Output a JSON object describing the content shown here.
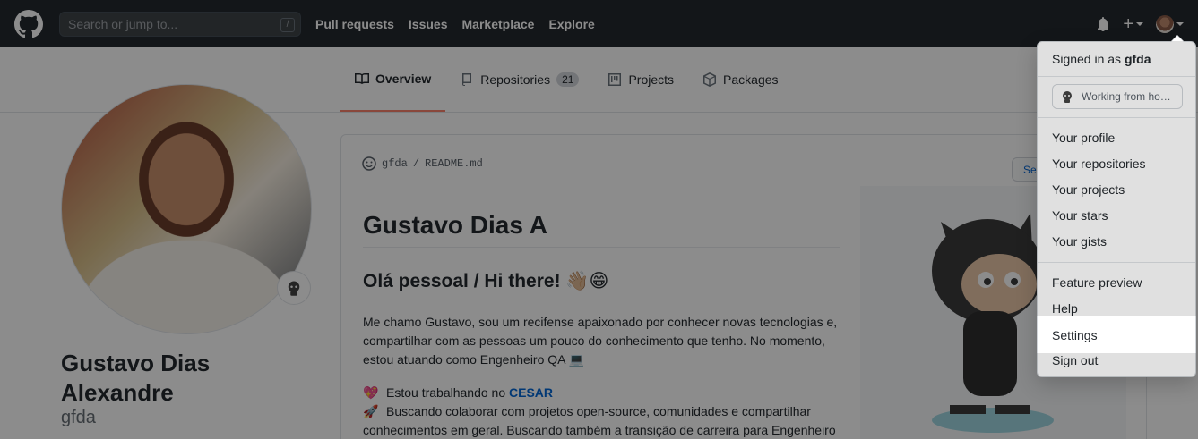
{
  "header": {
    "search_placeholder": "Search or jump to...",
    "search_shortcut": "/",
    "nav": [
      "Pull requests",
      "Issues",
      "Marketplace",
      "Explore"
    ],
    "plus_label": "+"
  },
  "tabs": [
    {
      "label": "Overview",
      "active": true
    },
    {
      "label": "Repositories",
      "count": "21"
    },
    {
      "label": "Projects"
    },
    {
      "label": "Packages"
    }
  ],
  "profile": {
    "full_name": "Gustavo Dias Alexandre",
    "login": "gfda"
  },
  "readme": {
    "path_user": "gfda",
    "path_sep": "/",
    "path_file": "README.md",
    "see_button": "See",
    "h1": "Gustavo Dias A",
    "h2": "Olá pessoal / Hi there! 👋🏼😁",
    "intro": "Me chamo Gustavo, sou um recifense apaixonado por conhecer novas tecnologias e, compartilhar com as pessoas um pouco do conhecimento que tenho. No momento, estou atuando como Engenheiro QA 💻",
    "item1_emoji": "💖",
    "item1_text": "Estou trabalhando no ",
    "item1_link": "CESAR",
    "item2_emoji": "🚀",
    "item2_text": "Buscando colaborar com projetos open-source, comunidades e compartilhar conhecimentos em geral. Buscando também a transição de carreira para Engenheiro"
  },
  "dropdown": {
    "signed_prefix": "Signed in as",
    "signed_user": "gfda",
    "status": "Working from ho…",
    "group1": [
      "Your profile",
      "Your repositories",
      "Your projects",
      "Your stars",
      "Your gists"
    ],
    "group2": [
      "Feature preview",
      "Help",
      "Settings",
      "Sign out"
    ]
  }
}
